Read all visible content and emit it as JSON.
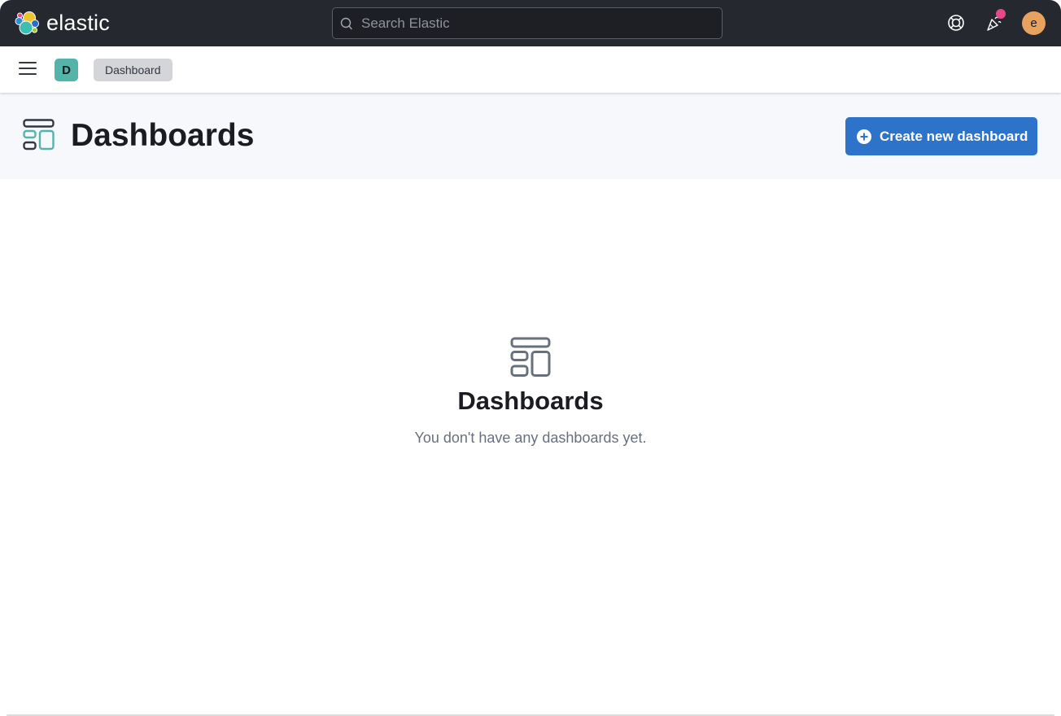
{
  "topbar": {
    "logo_text": "elastic",
    "search_placeholder": "Search Elastic",
    "search_value": "",
    "help_icon": "lifebuoy-icon",
    "news_icon": "party-popper-icon",
    "avatar_initial": "e",
    "colors": {
      "background": "#25282f",
      "avatar": "#e7a25f",
      "notification_dot": "#e8488b"
    }
  },
  "subbar": {
    "menu_icon": "hamburger-icon",
    "space_initial": "D",
    "breadcrumb": "Dashboard",
    "colors": {
      "space_badge": "#54b4a9"
    }
  },
  "page_header": {
    "icon": "dashboard-app-icon",
    "title": "Dashboards",
    "create_button_label": "Create new dashboard",
    "colors": {
      "primary_button": "#2d73c9"
    }
  },
  "empty_state": {
    "icon": "dashboard-app-icon",
    "title": "Dashboards",
    "message": "You don't have any dashboards yet."
  }
}
